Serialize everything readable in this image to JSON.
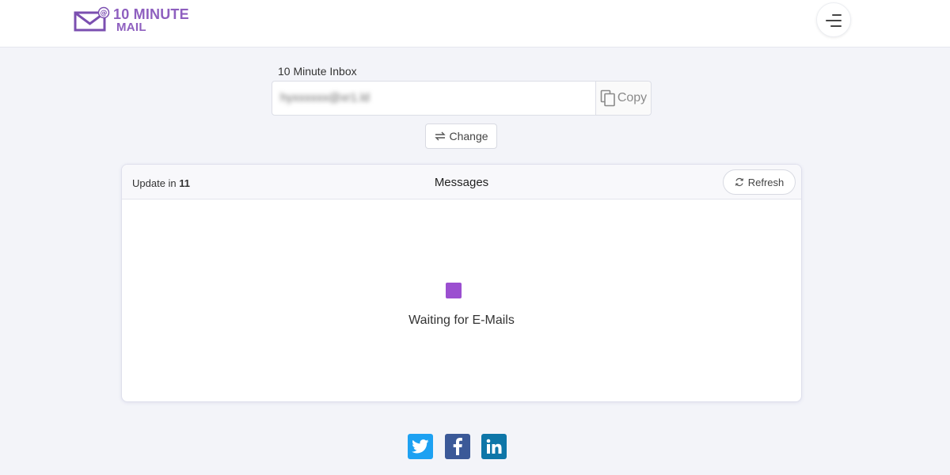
{
  "brand": {
    "line1": "10 MINUTE",
    "line2": "MAIL",
    "color": "#8e5fbf"
  },
  "header": {
    "menu_icon": "hamburger-menu-icon"
  },
  "inbox": {
    "label": "10 Minute Inbox",
    "email": "hyxxxxxx@xr1.ld",
    "email_blurred": true,
    "copy_label": "Copy",
    "change_label": "Change"
  },
  "messages": {
    "update_prefix": "Update in",
    "update_seconds": "11",
    "title": "Messages",
    "refresh_label": "Refresh",
    "waiting_text": "Waiting for E-Mails",
    "loader_color": "#9b4fd0"
  },
  "social": [
    {
      "name": "twitter",
      "icon": "twitter-icon",
      "color": "#1da1f2"
    },
    {
      "name": "facebook",
      "icon": "facebook-icon",
      "color": "#3b5998"
    },
    {
      "name": "linkedin",
      "icon": "linkedin-icon",
      "color": "#0e76a8"
    }
  ]
}
